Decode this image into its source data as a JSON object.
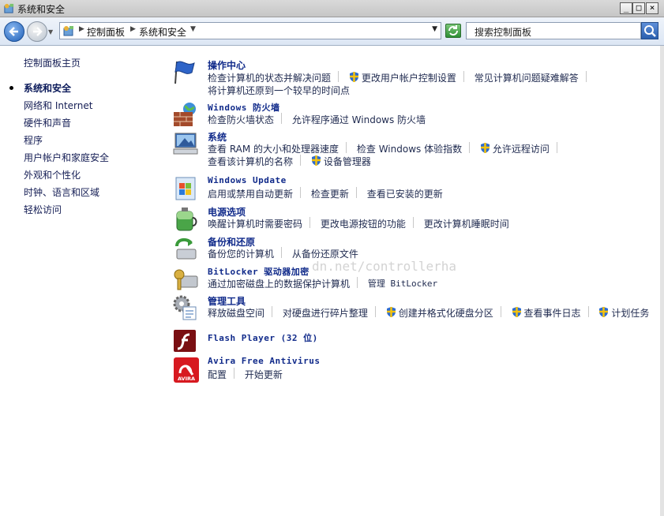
{
  "window": {
    "title": "系统和安全",
    "min_label": "_",
    "max_label": "□",
    "close_label": "×"
  },
  "address": {
    "crumbs": [
      "控制面板",
      "系统和安全"
    ],
    "search_placeholder": "搜索控制面板"
  },
  "sidebar": {
    "home": "控制面板主页",
    "items": [
      {
        "label": "系统和安全",
        "current": true
      },
      {
        "label": "网络和 Internet"
      },
      {
        "label": "硬件和声音"
      },
      {
        "label": "程序"
      },
      {
        "label": "用户帐户和家庭安全"
      },
      {
        "label": "外观和个性化"
      },
      {
        "label": "时钟、语言和区域"
      },
      {
        "label": "轻松访问"
      }
    ]
  },
  "categories": [
    {
      "title": "操作中心",
      "icon": "flag-icon",
      "lines": [
        [
          "检查计算机的状态并解决问题",
          "更改用户帐户控制设置",
          "常见计算机问题疑难解答"
        ],
        [
          "将计算机还原到一个较早的时间点"
        ]
      ]
    },
    {
      "title": "Windows 防火墙",
      "icon": "firewall-icon",
      "lines": [
        [
          "检查防火墙状态",
          "允许程序通过 Windows 防火墙"
        ]
      ]
    },
    {
      "title": "系统",
      "icon": "system-icon",
      "lines": [
        [
          "查看 RAM 的大小和处理器速度",
          "检查 Windows 体验指数",
          "允许远程访问"
        ],
        [
          "查看该计算机的名称",
          "设备管理器"
        ]
      ]
    },
    {
      "title": "Windows Update",
      "icon": "windows-update-icon",
      "lines": [
        [
          "启用或禁用自动更新",
          "检查更新",
          "查看已安装的更新"
        ]
      ]
    },
    {
      "title": "电源选项",
      "icon": "power-icon",
      "lines": [
        [
          "唤醒计算机时需要密码",
          "更改电源按钮的功能",
          "更改计算机睡眠时间"
        ]
      ]
    },
    {
      "title": "备份和还原",
      "icon": "backup-icon",
      "lines": [
        [
          "备份您的计算机",
          "从备份还原文件"
        ]
      ]
    },
    {
      "title": "BitLocker 驱动器加密",
      "icon": "bitlocker-icon",
      "lines": [
        [
          "通过加密磁盘上的数据保护计算机",
          "管理 BitLocker"
        ]
      ]
    },
    {
      "title": "管理工具",
      "icon": "admin-tools-icon",
      "lines": [
        [
          "释放磁盘空间",
          "对硬盘进行碎片整理",
          "创建并格式化硬盘分区",
          "查看事件日志",
          "计划任务"
        ]
      ]
    },
    {
      "title": "Flash Player (32 位)",
      "icon": "flash-icon",
      "lines": []
    },
    {
      "title": "Avira Free Antivirus",
      "icon": "avira-icon",
      "icon_text": "AVIRA",
      "lines": [
        [
          "配置",
          "开始更新"
        ]
      ]
    }
  ],
  "watermark": "dn.net/controllerha"
}
